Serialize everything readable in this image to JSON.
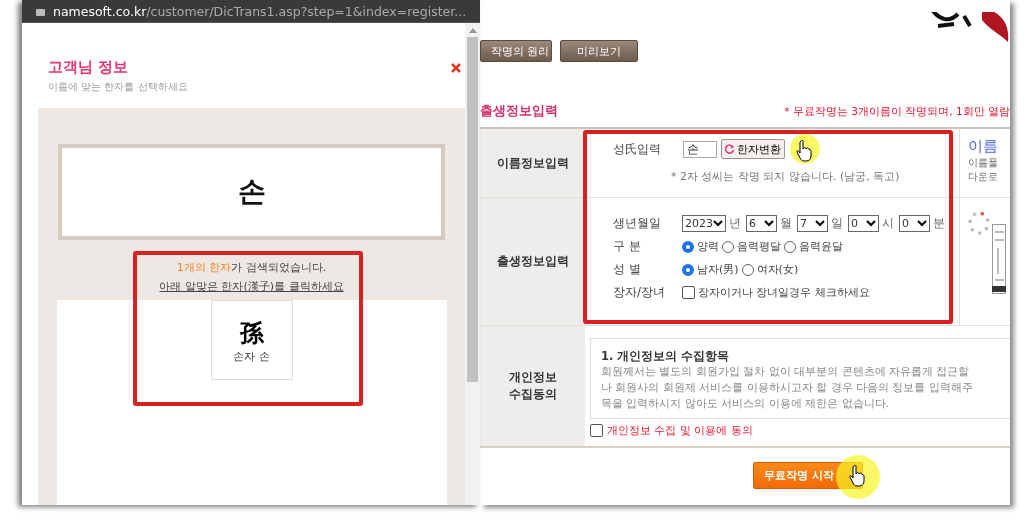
{
  "popup": {
    "url_domain": "namesoft.co.kr",
    "url_path": "/customer/DicTrans1.asp?step=1&index=register...",
    "title": "고객님 정보",
    "subtitle": "이름에 맞는 한자를 선택하세요",
    "name": "손",
    "result_count": "1개의 한자",
    "result_text": "가 검색되었습니다.",
    "instruction": "아래 알맞은 한자(漢子)를 클릭하세요",
    "hanja": [
      {
        "char": "孫",
        "reading": "손자 손"
      }
    ]
  },
  "page": {
    "tabs": [
      {
        "label": "작명의 원리"
      },
      {
        "label": "미리보기"
      }
    ],
    "section_title": "출생정보입력",
    "notice": "* 무료작명는 3개이름이 작명되며, 1회만 열람",
    "name_row": {
      "label": "이름정보입력",
      "surname_label": "성氏입력",
      "surname_value": "손",
      "convert_button": "한자변환",
      "hint": "* 2자 성씨는 작명 되지 않습니다. (남궁, 독고)"
    },
    "birth_row": {
      "label": "출생정보입력",
      "date_label": "생년월일",
      "selects": [
        {
          "value": "2023",
          "unit": "년"
        },
        {
          "value": "6",
          "unit": "월"
        },
        {
          "value": "7",
          "unit": "일"
        },
        {
          "value": "0",
          "unit": "시"
        },
        {
          "value": "0",
          "unit": "분"
        }
      ],
      "calendar": {
        "label": "구 분",
        "options": [
          {
            "label": "양력",
            "selected": true
          },
          {
            "label": "음력평달",
            "selected": false
          },
          {
            "label": "음력윤달",
            "selected": false
          }
        ]
      },
      "gender": {
        "label": "성 별",
        "options": [
          {
            "label": "남자(男)",
            "selected": true
          },
          {
            "label": "여자(女)",
            "selected": false
          }
        ]
      },
      "eldest": {
        "label": "장자/장녀",
        "text": "장자이거나 장녀일경우 체크하세요",
        "checked": false
      }
    },
    "side_ad": {
      "title": "이름",
      "lines": [
        "이름풀",
        "다운로"
      ]
    },
    "privacy_row": {
      "label": "개인정보 수집동의",
      "heading": "1. 개인정보의 수집항목",
      "lines": [
        "회원께서는 별도의 회원가입 절차 없이 대부분의 콘텐츠에 자유롭게 접근할",
        "나 회원사의 회원제 서비스를 이용하시고자 할 경우 다음의 정보를 입력해주",
        "목을 입력하시지 않아도 서비스의 이용에 제한은 없습니다."
      ],
      "agree": {
        "label": "개인정보 수집 및 이용에 동의",
        "checked": false
      }
    },
    "submit": "무료작명 시작"
  }
}
